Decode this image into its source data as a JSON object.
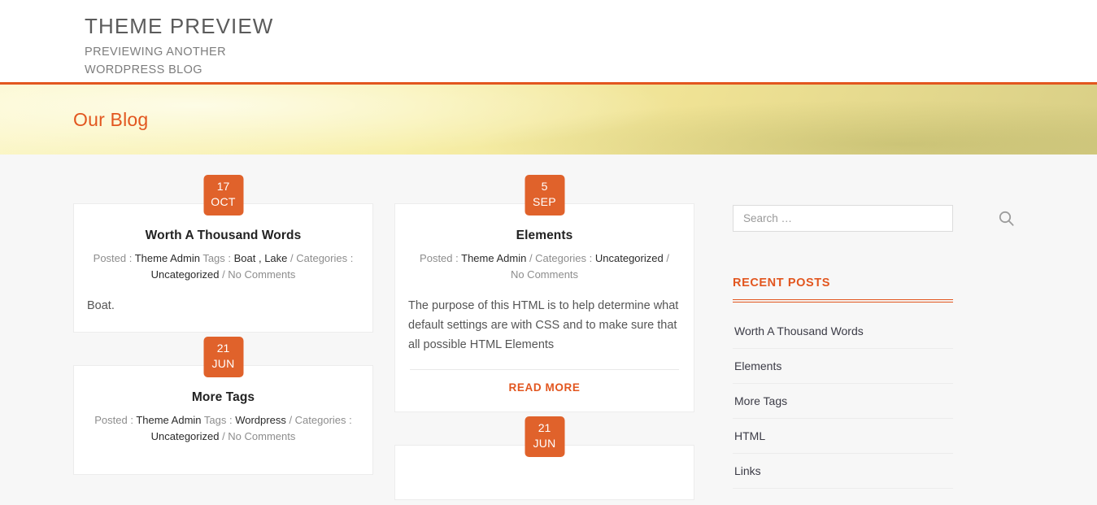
{
  "header": {
    "site_title": "THEME PREVIEW",
    "tagline": "PREVIEWING ANOTHER WORDPRESS BLOG"
  },
  "banner": {
    "title": "Our Blog"
  },
  "colors": {
    "accent": "#e2561f",
    "badge": "#e0622b",
    "page_bg": "#f7f7f7",
    "card_bg": "#ffffff",
    "heading": "#222222",
    "meta": "#8d8d8d"
  },
  "posts": {
    "column_left": [
      {
        "day": "17",
        "month": "OCT",
        "title": "Worth A Thousand Words",
        "meta": {
          "posted_label": "Posted : ",
          "author": "Theme Admin",
          "tags_label": " Tags : ",
          "tags": "Boat , Lake",
          "categories_label": " / Categories : ",
          "categories": "Uncategorized",
          "comments": " / No Comments"
        },
        "excerpt": "Boat.",
        "read_more": ""
      },
      {
        "day": "21",
        "month": "JUN",
        "title": "More Tags",
        "meta": {
          "posted_label": "Posted : ",
          "author": "Theme Admin",
          "tags_label": " Tags : ",
          "tags": "Wordpress",
          "categories_label": " / Categories : ",
          "categories": "Uncategorized",
          "comments": " / No Comments"
        },
        "excerpt": "",
        "read_more": ""
      }
    ],
    "column_right": [
      {
        "day": "5",
        "month": "SEP",
        "title": "Elements",
        "meta": {
          "posted_label": "Posted : ",
          "author": "Theme Admin",
          "tags_label": "",
          "tags": "",
          "categories_label": " / Categories : ",
          "categories": "Uncategorized",
          "comments": " / No Comments"
        },
        "excerpt": "The purpose of this HTML is to help determine what default settings are with CSS and to make sure that all possible HTML Elements",
        "read_more": "READ MORE"
      },
      {
        "day": "21",
        "month": "JUN",
        "title": "",
        "meta": {
          "posted_label": "",
          "author": "",
          "tags_label": "",
          "tags": "",
          "categories_label": "",
          "categories": "",
          "comments": ""
        },
        "excerpt": "",
        "read_more": ""
      }
    ]
  },
  "sidebar": {
    "search": {
      "placeholder": "Search …",
      "value": "",
      "icon": "search-icon"
    },
    "recent_posts": {
      "title": "RECENT POSTS",
      "items": [
        {
          "label": "Worth A Thousand Words"
        },
        {
          "label": "Elements"
        },
        {
          "label": "More Tags"
        },
        {
          "label": "HTML"
        },
        {
          "label": "Links"
        }
      ]
    }
  }
}
